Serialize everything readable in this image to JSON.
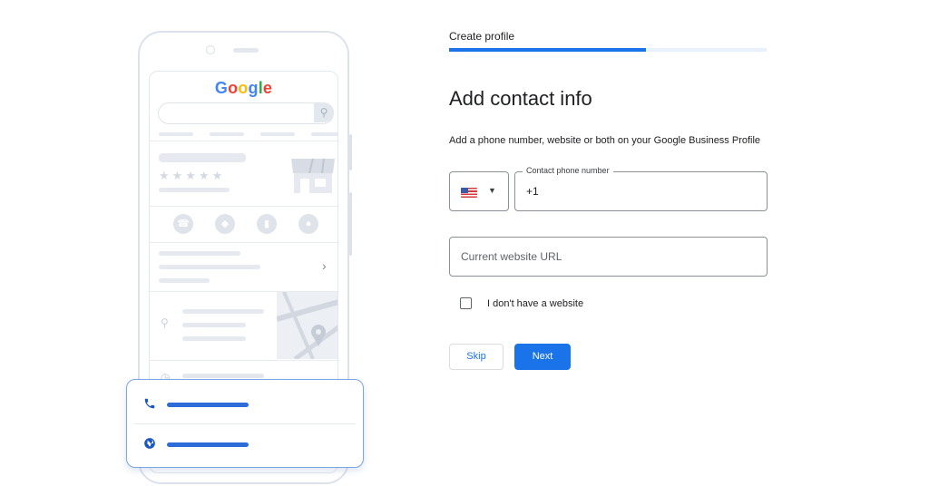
{
  "illustration": {
    "logo_letters": [
      {
        "ch": "G",
        "color": "#4285f4"
      },
      {
        "ch": "o",
        "color": "#ea4335"
      },
      {
        "ch": "o",
        "color": "#fbbc05"
      },
      {
        "ch": "g",
        "color": "#4285f4"
      },
      {
        "ch": "l",
        "color": "#34a853"
      },
      {
        "ch": "e",
        "color": "#ea4335"
      }
    ],
    "rating_stars": "★★★★★",
    "action_icons": [
      "phone-icon",
      "directions-icon",
      "bookmark-icon",
      "globe-icon"
    ],
    "card_icons": [
      "phone-icon",
      "globe-icon"
    ],
    "accent_color": "#2c6bd8"
  },
  "form": {
    "breadcrumb": "Create profile",
    "progress_fraction": 0.62,
    "title": "Add contact info",
    "subtitle": "Add a phone number, website or both on your Google Business Profile",
    "country_flag": "us-flag-icon",
    "phone": {
      "label": "Contact phone number",
      "value": "+1"
    },
    "website": {
      "placeholder": "Current website URL"
    },
    "no_website_label": "I don't have a website",
    "skip_label": "Skip",
    "next_label": "Next",
    "primary_color": "#1a73e8"
  }
}
